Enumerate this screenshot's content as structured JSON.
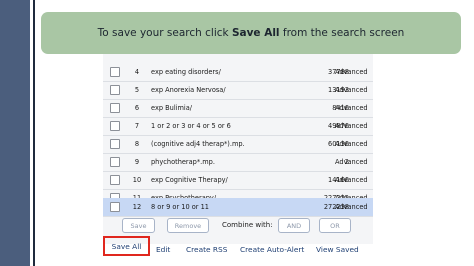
{
  "banner": {
    "text_before": "To save your search click ",
    "text_bold": "Save All",
    "text_after": " from the search screen"
  },
  "history": {
    "rows": [
      {
        "num": "4",
        "query": "exp eating disorders/",
        "results": "37788",
        "type": "Advanced",
        "selected": false
      },
      {
        "num": "5",
        "query": "exp Anorexia Nervosa/",
        "results": "13193",
        "type": "Advanced",
        "selected": false
      },
      {
        "num": "6",
        "query": "exp Bulimia/",
        "results": "8416",
        "type": "Advanced",
        "selected": false
      },
      {
        "num": "7",
        "query": "1 or 2 or 3 or 4 or 5 or 6",
        "results": "49876",
        "type": "Advanced",
        "selected": false
      },
      {
        "num": "8",
        "query": "(cognitive adj4 therap*).mp.",
        "results": "60136",
        "type": "Advanced",
        "selected": false
      },
      {
        "num": "9",
        "query": "phychotherap*.mp.",
        "results": "2",
        "type": "Advanced",
        "selected": false
      },
      {
        "num": "10",
        "query": "exp Cognitive Therapy/",
        "results": "14166",
        "type": "Advanced",
        "selected": false
      },
      {
        "num": "11",
        "query": "exp Psychotherapy/",
        "results": "227225",
        "type": "Advanced",
        "selected": false
      },
      {
        "num": "12",
        "query": "8 or 9 or 10 or 11",
        "results": "272238",
        "type": "Advanced",
        "selected": true
      }
    ]
  },
  "actions": {
    "save": "Save",
    "remove": "Remove",
    "combine_label": "Combine with:",
    "and": "AND",
    "or": "OR"
  },
  "links": {
    "save_all": "Save All",
    "edit": "Edit",
    "create_rss": "Create RSS",
    "create_auto_alert": "Create Auto-Alert",
    "view_saved": "View Saved"
  },
  "colors": {
    "banner_bg": "#a9c6a4",
    "link": "#1f3f73",
    "highlight_border": "#e0271e",
    "selected_row": "#c7d8f4"
  }
}
